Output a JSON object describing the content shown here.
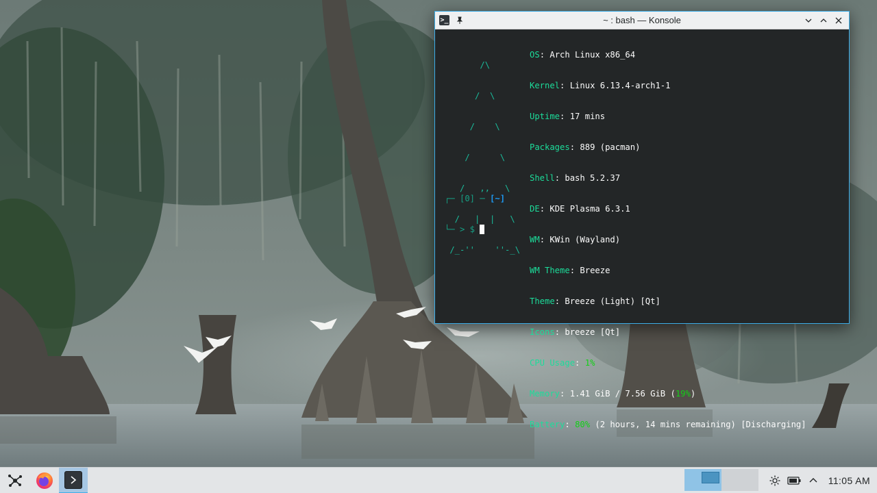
{
  "window": {
    "title": "~ : bash — Konsole",
    "app_icon_glyph": ">_",
    "icons": [
      "konsole-icon",
      "pin-icon",
      "chevron-down-icon",
      "chevron-up-icon",
      "close-icon"
    ]
  },
  "terminal": {
    "logo": [
      "       /\\",
      "      /  \\",
      "     /    \\",
      "    /      \\",
      "   /   ,,   \\",
      "  /   |  |   \\",
      " /_-''    ''-_\\"
    ],
    "info": [
      {
        "key": "OS",
        "value": "Arch Linux x86_64"
      },
      {
        "key": "Kernel",
        "value": "Linux 6.13.4-arch1-1"
      },
      {
        "key": "Uptime",
        "value": "17 mins"
      },
      {
        "key": "Packages",
        "value": "889 (pacman)"
      },
      {
        "key": "Shell",
        "value": "bash 5.2.37"
      },
      {
        "key": "DE",
        "value": "KDE Plasma 6.3.1"
      },
      {
        "key": "WM",
        "value": "KWin (Wayland)"
      },
      {
        "key": "WM Theme",
        "value": "Breeze"
      },
      {
        "key": "Theme",
        "value": "Breeze (Light) [Qt]"
      },
      {
        "key": "Icons",
        "value": "breeze [Qt]"
      },
      {
        "key": "CPU Usage",
        "value": "1%"
      },
      {
        "key": "Memory",
        "value_pre": "1.41 GiB / 7.56 GiB (",
        "value_pct": "19%",
        "value_post": ")"
      },
      {
        "key": "Battery",
        "value_pct": "80%",
        "value_post": " (2 hours, 14 mins remaining) [Discharging]"
      }
    ],
    "prompt_line1_pre": "┌─ [0] ─ ",
    "prompt_dir": "[~]",
    "prompt_line2": "└─ > $ "
  },
  "taskbar": {
    "launcher_icon": "kde-launcher-icon",
    "tasks": [
      {
        "name": "Firefox",
        "icon": "firefox-icon"
      },
      {
        "name": "Konsole",
        "icon": "konsole-icon",
        "active": true
      }
    ],
    "pager_desktops": 2,
    "tray_icons": [
      "brightness-icon",
      "battery-icon",
      "expand-tray-icon"
    ],
    "clock": "11:05 AM"
  },
  "colors": {
    "accent": "#3daee9",
    "terminal_bg": "#232627",
    "logo": "#1abc9c",
    "key": "#1cdc9a",
    "percent": "#11d116"
  }
}
